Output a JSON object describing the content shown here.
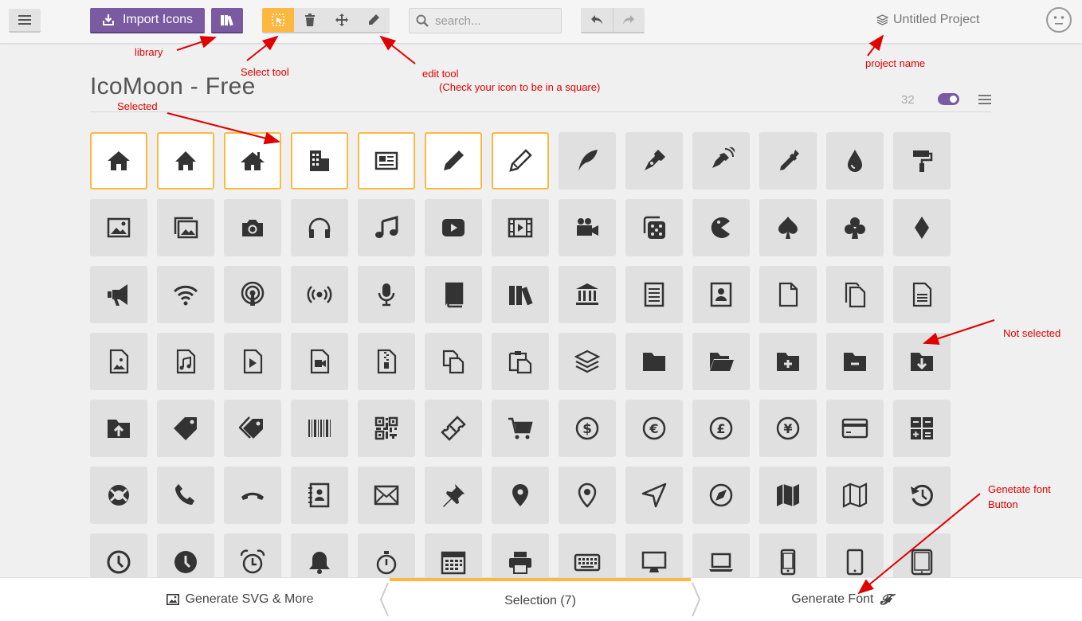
{
  "toolbar": {
    "import_label": "Import Icons",
    "search_placeholder": "search...",
    "project_name": "Untitled Project"
  },
  "colors": {
    "accent": "#ffb83f",
    "brand": "#7a5aa0",
    "annotation": "#e00000"
  },
  "annotations": {
    "library": "library",
    "select_tool": "Select tool",
    "edit_tool": "edit tool",
    "edit_tool_hint": "(Check your icon to be in a square)",
    "project_name": "project name",
    "selected": "Selected",
    "not_selected": "Not selected",
    "generate_font_1": "Genetate font",
    "generate_font_2": "Button"
  },
  "icon_set": {
    "title": "IcoMoon - Free",
    "count": "32"
  },
  "icons": [
    "home",
    "home2",
    "home3",
    "office",
    "newspaper",
    "pencil",
    "pencil2",
    "quill",
    "pen",
    "blog",
    "eyedropper",
    "droplet",
    "paint-format",
    "image",
    "images",
    "camera",
    "headphones",
    "music",
    "play",
    "film",
    "video-camera",
    "dice",
    "pacman",
    "spades",
    "clubs",
    "diamonds",
    "bullhorn",
    "connection",
    "podcast",
    "feed",
    "mic",
    "book",
    "books",
    "library",
    "file-text",
    "profile",
    "file-empty",
    "files-empty",
    "file-text2",
    "file-picture",
    "file-music",
    "file-play",
    "file-video",
    "file-zip",
    "copy",
    "paste",
    "stack",
    "folder",
    "folder-open",
    "folder-plus",
    "folder-minus",
    "folder-download",
    "folder-upload",
    "price-tag",
    "price-tags",
    "barcode",
    "qrcode",
    "ticket",
    "cart",
    "coin-dollar",
    "coin-euro",
    "coin-pound",
    "coin-yen",
    "credit-card",
    "calculator",
    "lifebuoy",
    "phone",
    "phone-hang-up",
    "address-book",
    "envelop",
    "pushpin",
    "location",
    "location2",
    "compass",
    "compass2",
    "map",
    "map2",
    "history",
    "clock",
    "clock2",
    "alarm",
    "bell",
    "stopwatch",
    "calendar",
    "printer",
    "keyboard",
    "display",
    "laptop",
    "mobile",
    "mobile2",
    "tablet"
  ],
  "selected_count": 7,
  "footer": {
    "svg_label": "Generate SVG & More",
    "selection_label": "Selection (7)",
    "font_label": "Generate Font"
  }
}
